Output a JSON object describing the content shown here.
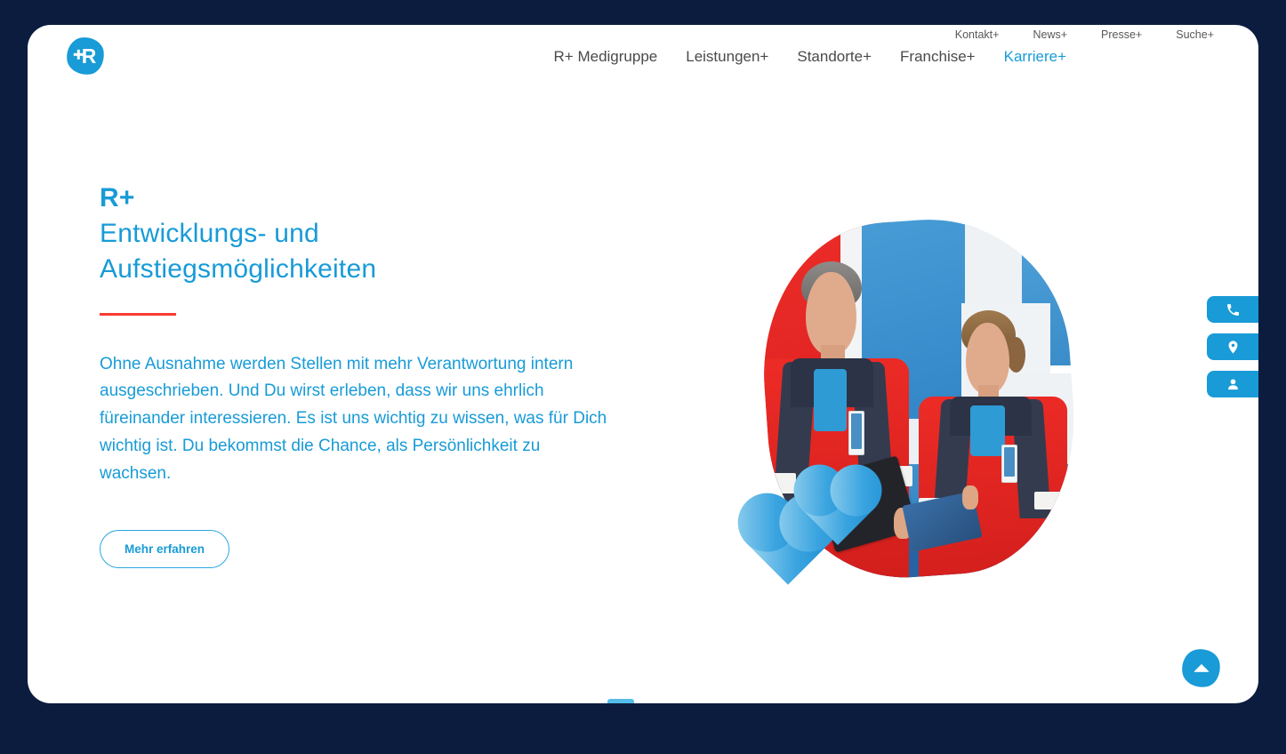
{
  "site": {
    "logo_letter": "R",
    "logo_icon": "r-plus-logo"
  },
  "header": {
    "utility_nav": [
      {
        "label": "Kontakt+"
      },
      {
        "label": "News+"
      },
      {
        "label": "Presse+"
      },
      {
        "label": "Suche+"
      }
    ],
    "main_nav": [
      {
        "label": "R+ Medigruppe",
        "active": false
      },
      {
        "label": "Leistungen+",
        "active": false
      },
      {
        "label": "Standorte+",
        "active": false
      },
      {
        "label": "Franchise+",
        "active": false
      },
      {
        "label": "Karriere+",
        "active": true
      }
    ]
  },
  "hero": {
    "eyebrow": "R+",
    "title": "Entwicklungs- und\nAufstiegsmöglichkeiten",
    "body": "Ohne Ausnahme werden Stellen mit mehr Verantwortung intern ausgeschrieben. Und Du wirst erleben, dass wir uns ehrlich füreinander interessieren. Es ist uns wichtig zu wissen, was für Dich wichtig ist. Du bekommst die Chance, als Persönlichkeit zu wachsen.",
    "cta_label": "Mehr erfahren",
    "image_alt": "Zwei Mitarbeitende in roten Jacken mit Tablets vor rot-blau-weißem Hintergrund"
  },
  "side_tabs": [
    {
      "icon": "phone-icon",
      "label": "Telefon"
    },
    {
      "icon": "map-pin-icon",
      "label": "Standort"
    },
    {
      "icon": "person-icon",
      "label": "Kontaktperson"
    }
  ],
  "scroll_top": {
    "icon": "chevron-up-icon",
    "label": "Nach oben"
  },
  "colors": {
    "brand_blue": "#189bd7",
    "accent_red": "#fa3c32",
    "page_background": "#0b1c3f",
    "nav_gray": "#585858",
    "surface": "#ffffff"
  }
}
